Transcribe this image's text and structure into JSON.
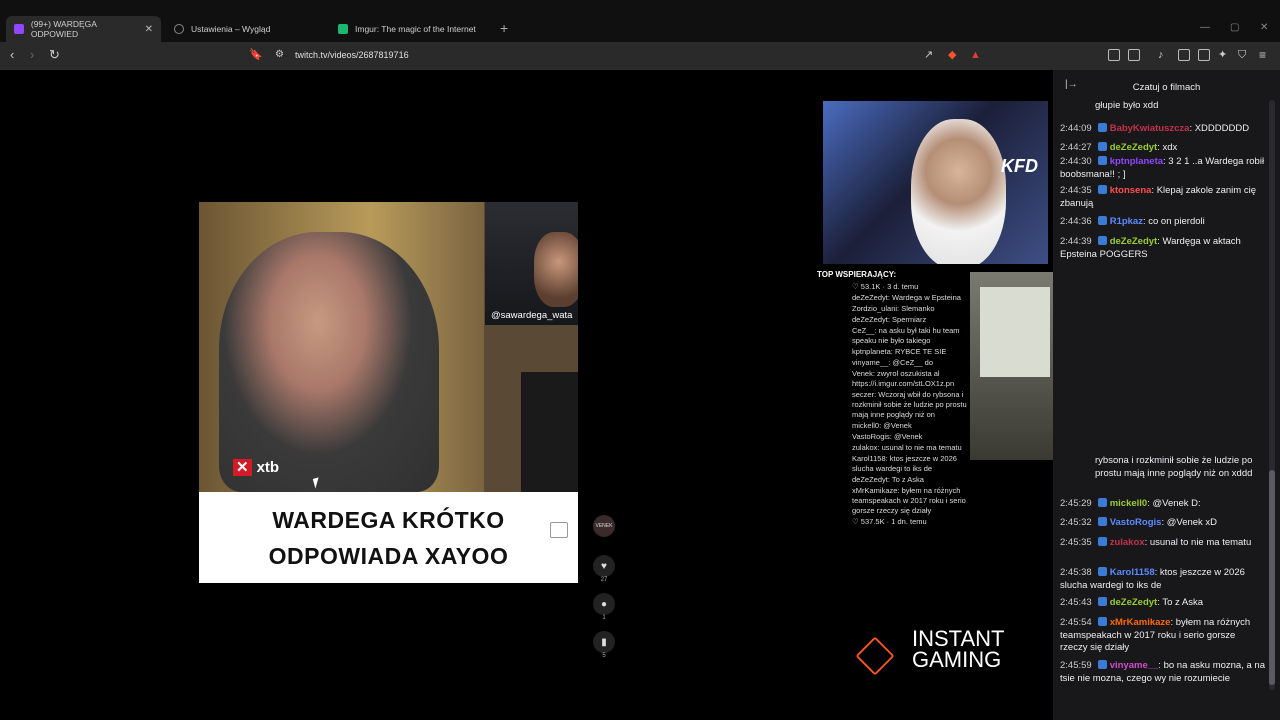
{
  "tabs": [
    {
      "title": "(99+) WARDĘGA ODPOWIED",
      "icon": "twitch-icon",
      "color": "#9146ff"
    },
    {
      "title": "Ustawienia – Wygląd",
      "icon": "gear-icon",
      "color": "#888888"
    },
    {
      "title": "Imgur: The magic of the Internet",
      "icon": "imgur-icon",
      "color": "#1bb76e"
    }
  ],
  "url": "twitch.tv/videos/2687819716",
  "video": {
    "caption_line1": "WARDEGA KRÓTKO",
    "caption_line2": "ODPOWIADA XAYOO",
    "handle": "@sawardega_wata",
    "sponsor": "xtb",
    "likes": "27",
    "comments": "1",
    "saves": "5",
    "avatar_label": "VENEK"
  },
  "overlay": {
    "top_supporters": "TOP WSPIERAJĄCY:",
    "cam_logo": "KFD",
    "instant_line1": "INSTANT",
    "instant_line2": "GAMING",
    "mini_chat": [
      "♡ 53.1K · 3 d. temu",
      "deZeZedyt: Wardega w Epsteina",
      "Zordzio_ulani: Slemanko",
      "deZeZedyt: Spermiarz",
      "CeZ__: na asku był taki hu team speaku nie było takiego",
      "kptnplaneta: RYBCE TE SIE",
      "vinyame__: @CeZ__ do",
      "Venek: zwyrol oszukista al https://i.imgur.com/stLOX1z.pn",
      "seczer: Wczoraj wbił do rybsona i rozkminił sobie że ludzie po prostu mają inne poglądy niż on",
      "mickell0: @Venek",
      "VastoRogis: @Venek",
      "zulakox: usunal to nie ma tematu",
      "Karol1158: ktos jeszcze w 2026 slucha wardegi to iks de",
      "deZeZedyt: To z Aska",
      "xMrKamikaze: byłem na różnych teamspeakach w 2017 roku i serio gorsze rzeczy się działy",
      "♡ 537.5K · 1 dn. temu"
    ]
  },
  "chat": {
    "title": "Czatuj o filmach",
    "messages": [
      {
        "time": "",
        "user": "",
        "color": "#efeff1",
        "text": "głupie było xdd"
      },
      {
        "time": "2:44:09",
        "user": "BabyKwiatuszcza",
        "color": "#c4314b",
        "text": ": XDDDDDDD"
      },
      {
        "time": "2:44:27",
        "user": "deZeZedyt",
        "color": "#9acd32",
        "text": ": xdx"
      },
      {
        "time": "2:44:30",
        "user": "kptnplaneta",
        "color": "#9146ff",
        "text": ": 3 2 1 ..a Wardega robił boobsmana!! ; ]"
      },
      {
        "time": "2:44:35",
        "user": "ktonsena",
        "color": "#ff4d4d",
        "text": ": Klepaj zakole zanim cię zbanują"
      },
      {
        "time": "2:44:36",
        "user": "R1pkaz",
        "color": "#5b8cff",
        "text": ": co on pierdoli"
      },
      {
        "time": "2:44:39",
        "user": "deZeZedyt",
        "color": "#9acd32",
        "text": ": Wardęga w aktach Epsteina POGGERS"
      },
      {
        "time": "",
        "user": "",
        "color": "#efeff1",
        "text": "rybsona i rozkminił sobie że ludzie po prostu mają inne poglądy niż on xddd"
      },
      {
        "time": "2:45:29",
        "user": "mickell0",
        "color": "#9acd32",
        "text": ": @Venek D:"
      },
      {
        "time": "2:45:32",
        "user": "VastoRogis",
        "color": "#5b8cff",
        "text": ": @Venek xD"
      },
      {
        "time": "2:45:35",
        "user": "zulakox",
        "color": "#c4314b",
        "text": ": usunal to nie ma tematu"
      },
      {
        "time": "2:45:38",
        "user": "Karol1158",
        "color": "#5b8cff",
        "text": ": ktos jeszcze w 2026 slucha wardegi to iks de"
      },
      {
        "time": "2:45:43",
        "user": "deZeZedyt",
        "color": "#9acd32",
        "text": ": To z Aska"
      },
      {
        "time": "2:45:54",
        "user": "xMrKamikaze",
        "color": "#ff6a00",
        "text": ": byłem na różnych teamspeakach w 2017 roku i serio gorsze rzeczy się działy"
      },
      {
        "time": "2:45:59",
        "user": "vinyame__",
        "color": "#d04ccf",
        "text": ": bo na asku mozna, a na tsie nie mozna, czego wy nie rozumiecie"
      }
    ]
  }
}
